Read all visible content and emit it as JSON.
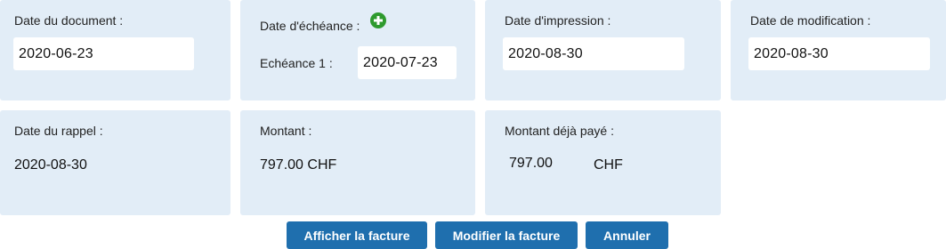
{
  "cards": {
    "document_date": {
      "label": "Date du document :",
      "value": "2020-06-23"
    },
    "due_date": {
      "label": "Date d'échéance :",
      "plus_icon": "plus-circle-icon",
      "installment_label": "Echéance 1 :",
      "installment_value": "2020-07-23"
    },
    "print_date": {
      "label": "Date d'impression :",
      "value": "2020-08-30"
    },
    "modification_date": {
      "label": "Date de modification :",
      "value": "2020-08-30"
    },
    "reminder_date": {
      "label": "Date du rappel :",
      "value": "2020-08-30"
    },
    "amount": {
      "label": "Montant :",
      "value": "797.00 CHF"
    },
    "amount_paid": {
      "label": "Montant déjà payé :",
      "value": "797.00",
      "currency": "CHF"
    }
  },
  "buttons": {
    "show_invoice": "Afficher la facture",
    "edit_invoice": "Modifier la facture",
    "cancel": "Annuler"
  },
  "colors": {
    "card_background": "#e2edf7",
    "button_background": "#1f6fae",
    "plus_icon": "#2e9a2e"
  }
}
